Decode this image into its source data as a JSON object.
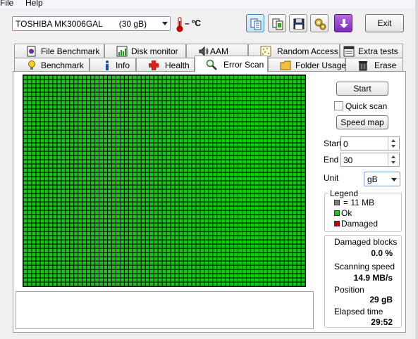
{
  "menu": {
    "file": "File",
    "help": "Help"
  },
  "toolbar": {
    "drive": "TOSHIBA MK3006GAL       (30 gB)",
    "temperature": "– ºC",
    "exit_label": "Exit",
    "buttons": [
      "copy-text-icon",
      "copy-screenshot-icon",
      "save-icon",
      "options-icon",
      "download-icon"
    ]
  },
  "tabs_top": [
    {
      "label": "File Benchmark",
      "icon": "file-benchmark-icon"
    },
    {
      "label": "Disk monitor",
      "icon": "disk-monitor-icon"
    },
    {
      "label": "AAM",
      "icon": "speaker-icon"
    },
    {
      "label": "Random Access",
      "icon": "random-access-icon"
    },
    {
      "label": "Extra tests",
      "icon": "extra-tests-icon"
    }
  ],
  "tabs_bottom": [
    {
      "label": "Benchmark",
      "icon": "lightbulb-icon"
    },
    {
      "label": "Info",
      "icon": "info-icon"
    },
    {
      "label": "Health",
      "icon": "health-cross-icon"
    },
    {
      "label": "Error Scan",
      "icon": "magnifier-icon"
    },
    {
      "label": "Folder Usage",
      "icon": "folder-icon"
    },
    {
      "label": "Erase",
      "icon": "trash-icon"
    }
  ],
  "active_tab": "Error Scan",
  "scan": {
    "start_button": "Start",
    "quick_scan_label": "Quick scan",
    "quick_scan_checked": false,
    "speed_map_button": "Speed map",
    "start_label": "Start",
    "start_value": "0",
    "end_label": "End",
    "end_value": "30",
    "unit_label": "Unit",
    "unit_value": "gB",
    "block_color": "#14c814",
    "grid_columns": 67,
    "grid_rows": 50
  },
  "legend": {
    "title": "Legend",
    "items": [
      {
        "label": "= 11 MB",
        "color": "#808080"
      },
      {
        "label": "Ok",
        "color": "#14c814"
      },
      {
        "label": "Damaged",
        "color": "#d00000"
      }
    ]
  },
  "stats": {
    "damaged_label": "Damaged blocks",
    "damaged_value": "0.0 %",
    "speed_label": "Scanning speed",
    "speed_value": "14.9 MB/s",
    "position_label": "Position",
    "position_value": "29 gB",
    "elapsed_label": "Elapsed time",
    "elapsed_value": "29:52"
  }
}
